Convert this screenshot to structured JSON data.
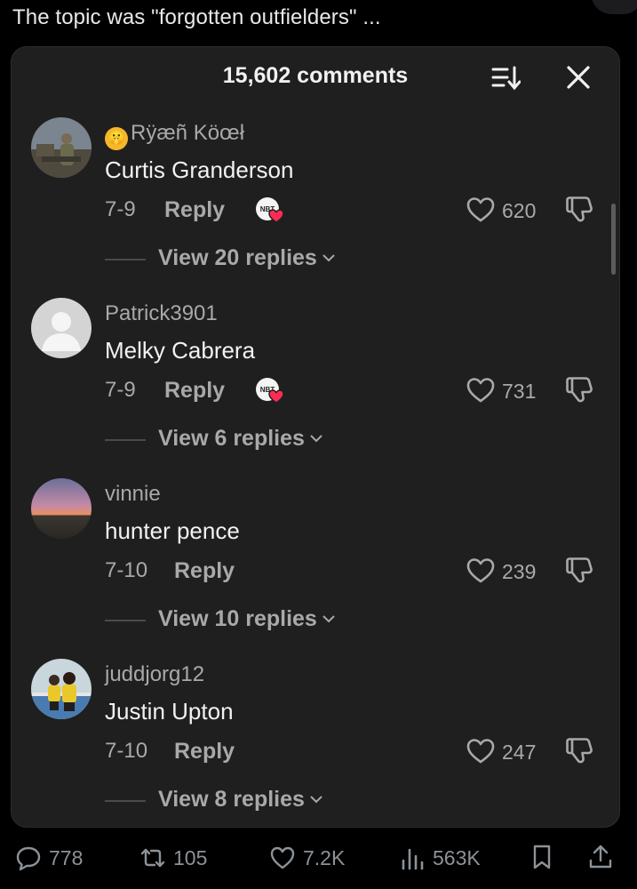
{
  "caption": "The topic was \"forgotten outfielders\" ...",
  "panel": {
    "title": "15,602 comments",
    "sort_icon": "sort-icon",
    "close_icon": "close-icon"
  },
  "comments": [
    {
      "username": "Rÿæñ Köœł",
      "username_emoji": "shushing-face-emoji",
      "text": "Curtis Granderson",
      "date": "7-9",
      "reply_label": "Reply",
      "creator_liked": true,
      "creator_badge_text": "NBT",
      "likes": "620",
      "view_replies": "View 20 replies",
      "avatar": "photo-soldiers"
    },
    {
      "username": "Patrick3901",
      "text": "Melky Cabrera",
      "date": "7-9",
      "reply_label": "Reply",
      "creator_liked": true,
      "creator_badge_text": "NBT",
      "likes": "731",
      "view_replies": "View 6 replies",
      "avatar": "default-person"
    },
    {
      "username": "vinnie",
      "text": "hunter pence",
      "date": "7-10",
      "reply_label": "Reply",
      "creator_liked": false,
      "likes": "239",
      "view_replies": "View 10 replies",
      "avatar": "photo-sunset"
    },
    {
      "username": "juddjorg12",
      "text": "Justin Upton",
      "date": "7-10",
      "reply_label": "Reply",
      "creator_liked": false,
      "likes": "247",
      "view_replies": "View 8 replies",
      "avatar": "photo-two-kids"
    }
  ],
  "bottom_bar": {
    "replies": "778",
    "reposts": "105",
    "likes": "7.2K",
    "views": "563K"
  },
  "colors": {
    "panel_bg": "#1f1f1f",
    "muted_text": "#a9a9a9",
    "heart_red": "#fe2c55"
  }
}
